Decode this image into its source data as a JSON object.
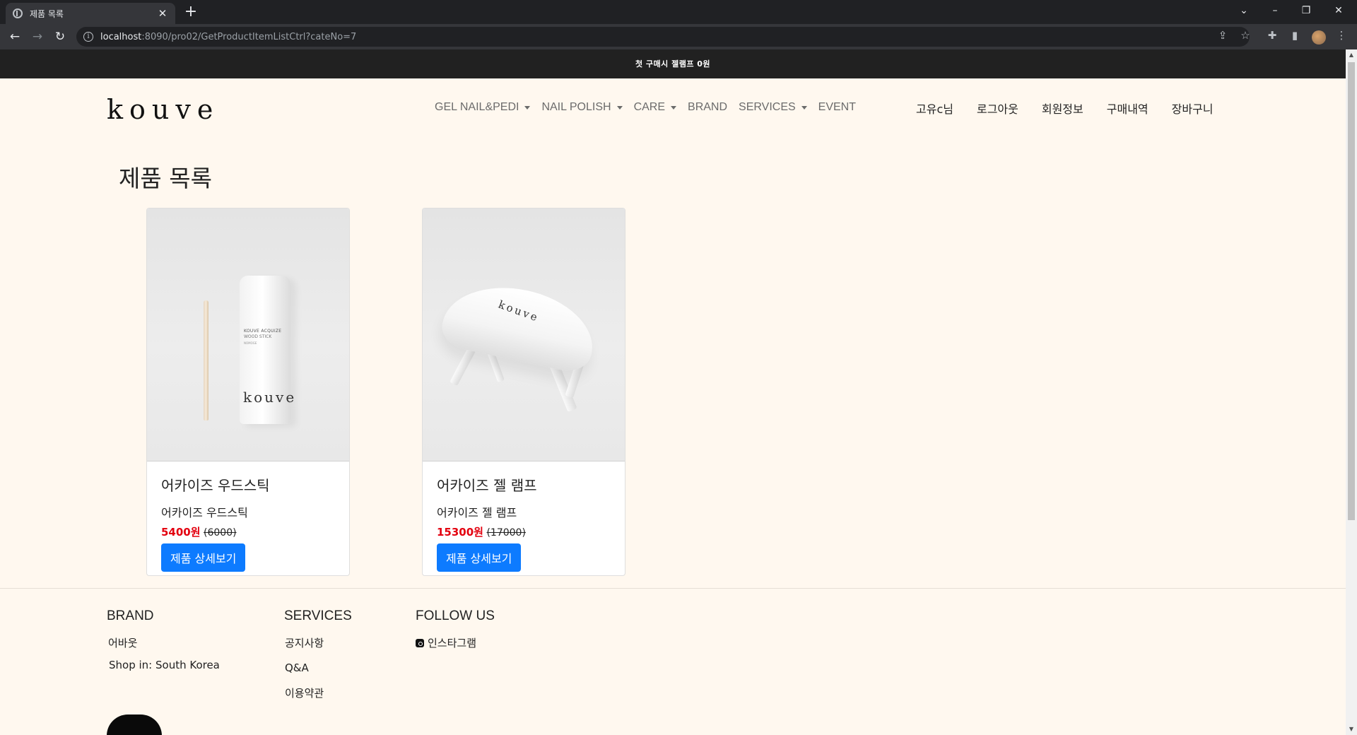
{
  "browser": {
    "tab_title": "제품 목록",
    "tab_close": "✕",
    "new_tab": "+",
    "url_host": "localhost",
    "url_rest": ":8090/pro02/GetProductItemListCtrl?cateNo=7"
  },
  "promo": {
    "text": "첫 구매시 젤램프 0원"
  },
  "header": {
    "logo": "kouve",
    "nav": [
      {
        "label": "GEL NAIL&PEDI",
        "dropdown": true
      },
      {
        "label": "NAIL POLISH",
        "dropdown": true
      },
      {
        "label": "CARE",
        "dropdown": true
      },
      {
        "label": "BRAND",
        "dropdown": false
      },
      {
        "label": "SERVICES",
        "dropdown": true
      },
      {
        "label": "EVENT",
        "dropdown": false
      }
    ],
    "user_nav": [
      "고유c님",
      "로그아웃",
      "회원정보",
      "구매내역",
      "장바구니"
    ]
  },
  "main": {
    "title": "제품 목록",
    "products": [
      {
        "name": "어카이즈 우드스틱",
        "description": "어카이즈 우드스틱",
        "sale_price": "5400원",
        "original_price": "(6000)",
        "button": "제품 상세보기",
        "image_labels": [
          "KOUVE ACQUIZE",
          "WOOD STICK",
          "NOMOGE",
          "kouve"
        ]
      },
      {
        "name": "어카이즈 젤 램프",
        "description": "어카이즈 젤 램프",
        "sale_price": "15300원",
        "original_price": "(17000)",
        "button": "제품 상세보기",
        "image_labels": [
          "kouve"
        ]
      }
    ]
  },
  "footer": {
    "brand": {
      "heading": "BRAND",
      "links": [
        "어바웃",
        "Shop in: South Korea"
      ]
    },
    "services": {
      "heading": "SERVICES",
      "links": [
        "공지사항",
        "Q&A",
        "이용약관"
      ]
    },
    "follow": {
      "heading": "FOLLOW US",
      "links": [
        "인스타그램"
      ]
    }
  },
  "colors": {
    "page_bg": "#fff8ef",
    "promo_bg": "#212121",
    "sale_red": "#e3000f",
    "button_blue": "#0d7bff"
  }
}
